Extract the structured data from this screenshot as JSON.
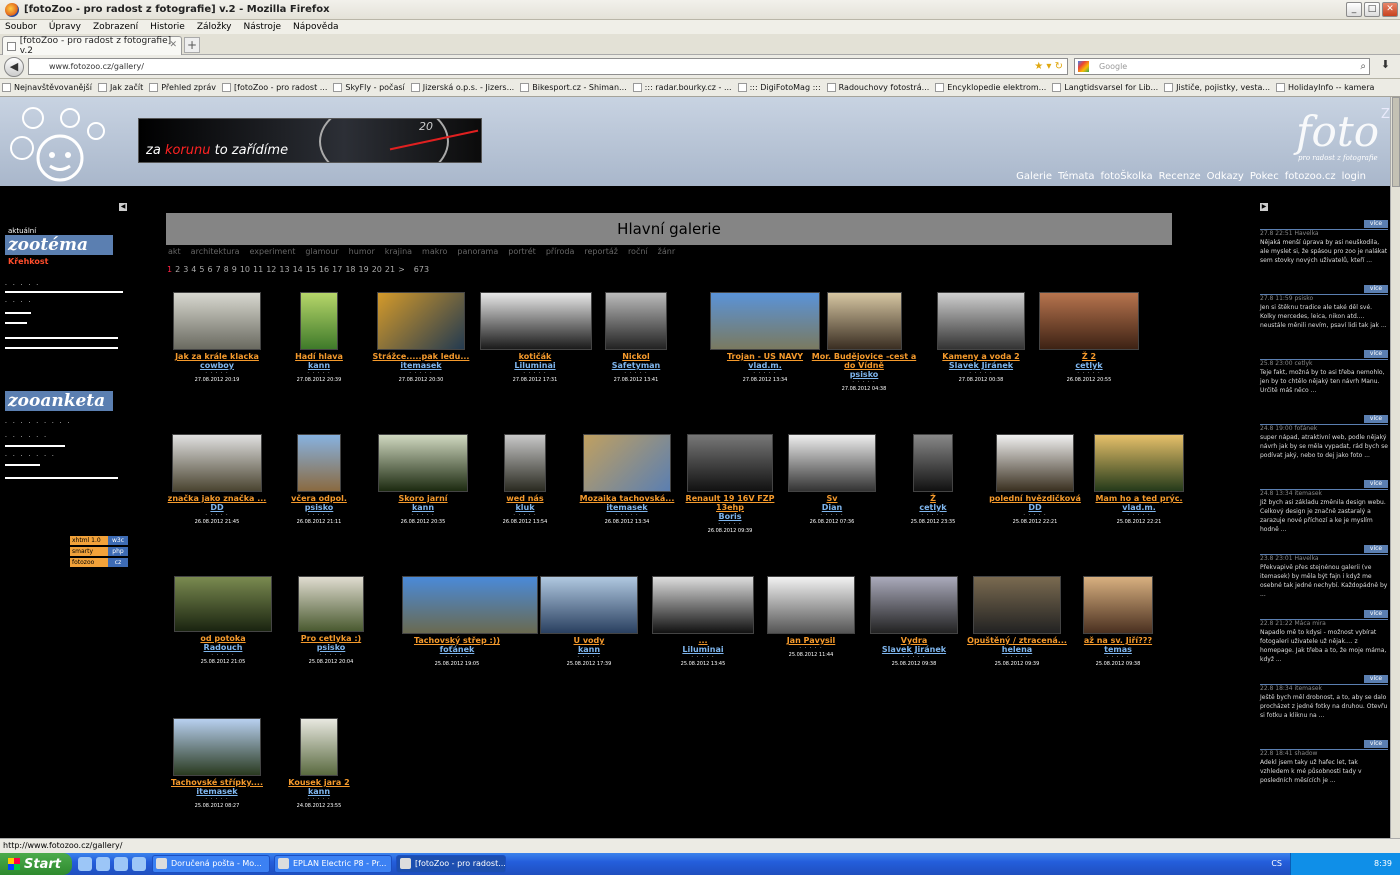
{
  "window": {
    "title": "[fotoZoo - pro radost z fotografie] v.2 - Mozilla Firefox"
  },
  "menu": [
    "Soubor",
    "Úpravy",
    "Zobrazení",
    "Historie",
    "Záložky",
    "Nástroje",
    "Nápověda"
  ],
  "tab": {
    "label": "[fotoZoo - pro radost z fotografie] v.2"
  },
  "url": "www.fotozoo.cz/gallery/",
  "search_placeholder": "Google",
  "bookmarks": [
    "Nejnavštěvovanější",
    "Jak začít",
    "Přehled zpráv",
    "[fotoZoo - pro radost ...",
    "SkyFly - počasí",
    "Jizerská o.p.s. - Jizers...",
    "Bikesport.cz - Shiman...",
    "::: radar.bourky.cz - ...",
    "::: DigiFotoMag :::",
    "Radouchovy fotostrá...",
    "Encyklopedie elektrom...",
    "Langtidsvarsel for Lib...",
    "Jističe, pojistky, vesta...",
    "HolidayInfo -- kamera"
  ],
  "ad": {
    "pre": "za ",
    "highlight": "korunu",
    "post": " to zařídíme",
    "gauge_num": "20"
  },
  "site": {
    "logo": "foto",
    "logo_sup": "Zoo",
    "tagline": "pro radost z fotografie",
    "nav": [
      "Galerie",
      "Témata",
      "fotoŠkolka",
      "Recenze",
      "Odkazy",
      "Pokec",
      "fotozoo.cz",
      "login"
    ]
  },
  "left": {
    "small_label": "aktuální",
    "zootema": "zootéma",
    "tema_value": "Křehkost",
    "zooanketa": "zooanketa",
    "badges": [
      [
        "xhtml 1.0",
        "w3c"
      ],
      [
        "smarty",
        "php"
      ],
      [
        "fotozoo",
        "cz"
      ]
    ]
  },
  "gallery": {
    "title": "Hlavní galerie",
    "categories": [
      "akt",
      "architektura",
      "experiment",
      "glamour",
      "humor",
      "krajina",
      "makro",
      "panorama",
      "portrét",
      "příroda",
      "reportáž",
      "roční",
      "žánr"
    ],
    "pages": [
      "1",
      "2",
      "3",
      "4",
      "5",
      "6",
      "7",
      "8",
      "9",
      "10",
      "11",
      "12",
      "13",
      "14",
      "15",
      "16",
      "17",
      "18",
      "19",
      "20",
      "21",
      ">",
      "673"
    ],
    "photos": [
      {
        "title": "Jak za krále klacka",
        "author": "cowboy",
        "date": "27.08.2012 20:19"
      },
      {
        "title": "Hadí hlava",
        "author": "kann",
        "date": "27.08.2012 20:39"
      },
      {
        "title": "Strážce.....pak ledu...",
        "author": "itemasek",
        "date": "27.08.2012 20:30"
      },
      {
        "title": "kotičák",
        "author": "Liluminai",
        "date": "27.08.2012 17:31"
      },
      {
        "title": "Nickol",
        "author": "Safetyman",
        "date": "27.08.2012 13:41"
      },
      {
        "title": "Trojan - US NAVY",
        "author": "vlad.m.",
        "date": "27.08.2012 13:34"
      },
      {
        "title": "Mor. Budějovice -cest a do Vídně",
        "author": "psisko",
        "date": "27.08.2012 04:38"
      },
      {
        "title": "Kameny a voda 2",
        "author": "Slavek Jiránek",
        "date": "27.08.2012 00:38"
      },
      {
        "title": "Ž 2",
        "author": "cetlyk",
        "date": "26.08.2012 20:55"
      },
      {
        "title": "značka jako značka ...",
        "author": "DD",
        "date": "26.08.2012 21:45"
      },
      {
        "title": "včera odpol.",
        "author": "psisko",
        "date": "26.08.2012 21:11"
      },
      {
        "title": "Skoro jarní",
        "author": "kann",
        "date": "26.08.2012 20:35"
      },
      {
        "title": "wed nás",
        "author": "kluk",
        "date": "26.08.2012 13:54"
      },
      {
        "title": "Mozaika tachovská...",
        "author": "itemasek",
        "date": "26.08.2012 13:34"
      },
      {
        "title": "Renault 19 16V FZP 13ehp",
        "author": "Boris",
        "date": "26.08.2012 09:39"
      },
      {
        "title": "Sv",
        "author": "Dian",
        "date": "26.08.2012 07:36"
      },
      {
        "title": "Ž",
        "author": "cetlyk",
        "date": "25.08.2012 23:35"
      },
      {
        "title": "polední hvězdičková",
        "author": "DD",
        "date": "25.08.2012 22:21"
      },
      {
        "title": "Mam ho a ted prýc.",
        "author": "vlad.m.",
        "date": "25.08.2012 22:21"
      },
      {
        "title": "od potoka",
        "author": "Radouch",
        "date": "25.08.2012 21:05"
      },
      {
        "title": "Pro cetlyka :)",
        "author": "psisko",
        "date": "25.08.2012 20:04"
      },
      {
        "title": "Tachovský střep :))",
        "author": "foťánek",
        "date": "25.08.2012 19:05"
      },
      {
        "title": "U vody",
        "author": "kann",
        "date": "25.08.2012 17:39"
      },
      {
        "title": "...",
        "author": "Liluminai",
        "date": "25.08.2012 13:45"
      },
      {
        "title": "Jan Pavysil",
        "author": "",
        "date": "25.08.2012 11:44"
      },
      {
        "title": "Vydra",
        "author": "Slavek Jiránek",
        "date": "25.08.2012 09:38"
      },
      {
        "title": "Opuštěný / ztracená...",
        "author": "helena",
        "date": "25.08.2012 09:39"
      },
      {
        "title": "až na sv. Jiří???",
        "author": "temas",
        "date": "25.08.2012 09:38"
      },
      {
        "title": "Tachovské střípky....",
        "author": "itemasek",
        "date": "25.08.2012 08:27"
      },
      {
        "title": "Kousek jara 2",
        "author": "kann",
        "date": "24.08.2012 23:55"
      }
    ]
  },
  "comments": {
    "button": "více",
    "items": [
      {
        "who": "27.8 22:51 Havelka",
        "text": "Nějaká menší úprava by asi neuškodila, ale myslet si, že spásou pro zoo je nalákat sem stovky nových uživatelů, kteří ..."
      },
      {
        "who": "27.8 11:59 psisko",
        "text": "Jen si štěknu tradice ale také děl své. Kolky mercedes, leica, nikon atd.... neustále měnili nevím, psaví lidi tak jak ..."
      },
      {
        "who": "25.8 23:00 cetlyk",
        "text": "Teje fakt, možná by to asi třeba nemohlo, jen by to chtělo nějaký ten návrh Manu. Určitě máš něco ..."
      },
      {
        "who": "24.8 19:00 foťánek",
        "text": "super nápad, atraktivní web, podle nějaký návrh jak by se měla vypadat, rád bych se podívat jaký, nebo to dej jako foto ..."
      },
      {
        "who": "24.8 13:34 itemasek",
        "text": "Již bych asi základu změnila design webu. Celkový design je značně zastaralý a zarazuje nové příchozí a ke je myslím hodně ..."
      },
      {
        "who": "23.8 23:01 Havelka",
        "text": "Překvapivě přes stejnénou galerii (ve itemasek) by měla být fajn i když me osebné tak jedné nechybí. Každopádně by ..."
      },
      {
        "who": "22.8 21:22 Máca mira",
        "text": "Napadlo mě to kdysi - možnost vybírat fotogaleri uživatele už nějak.... z homepage. Jak třeba a to, že moje máma, když ..."
      },
      {
        "who": "22.8 18:34 itemasek",
        "text": "Ještě bych měl drobnost, a to, aby se dalo procházet z jedné fotky na druhou. Otevřu si fotku a kliknu na ..."
      },
      {
        "who": "22.8 18:41 shadow",
        "text": "Adekl jsem taky už hafec let, tak vzhledem k mé působnosti tady v posledních měsících je ..."
      }
    ]
  },
  "status_url": "http://www.fotozoo.cz/gallery/",
  "taskbar": {
    "start": "Start",
    "buttons": [
      "Doručená pošta - Mo...",
      "EPLAN Electric P8 - Pr...",
      "[fotoZoo - pro radost..."
    ],
    "lang": "CS",
    "time": "8:39"
  },
  "colors": {
    "accent": "#5b7fb1",
    "title_orange": "#f59a2c",
    "author_blue": "#7fb6ee"
  }
}
